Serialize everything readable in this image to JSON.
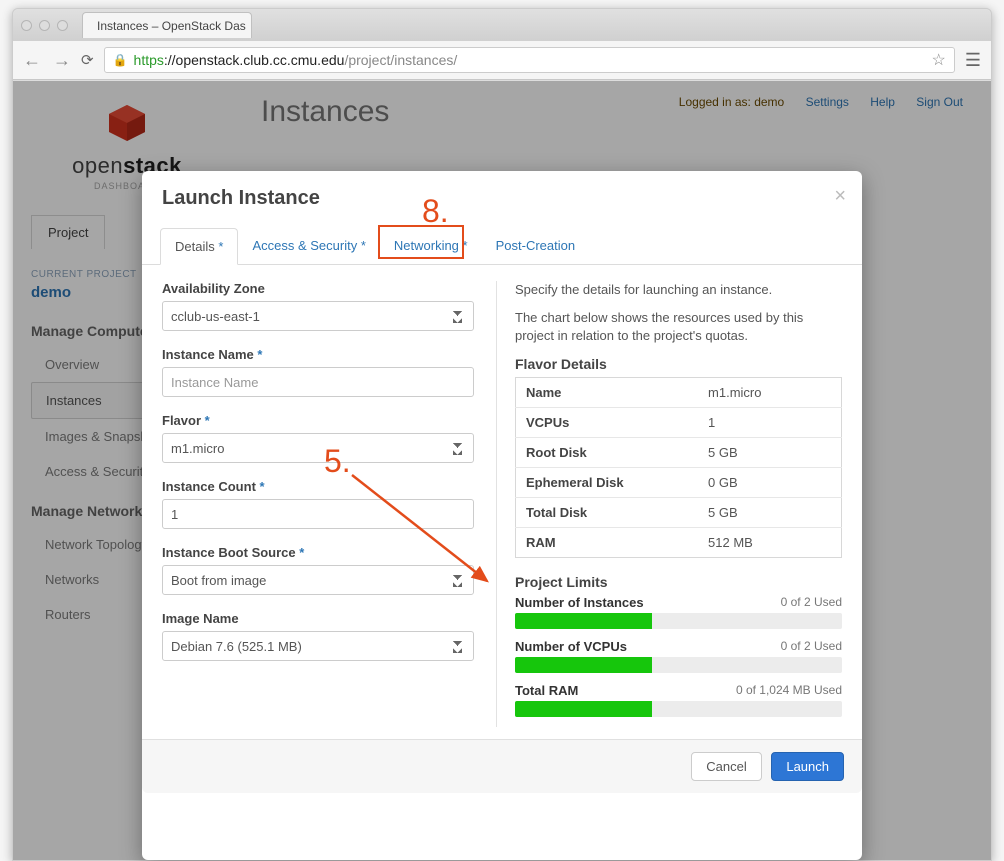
{
  "browser": {
    "tab_title": "Instances – OpenStack Das",
    "url_https": "https",
    "url_host": "://openstack.club.cc.cmu.edu",
    "url_path": "/project/instances/"
  },
  "sidebar": {
    "brand_open": "open",
    "brand_stack": "stack",
    "brand_sub": "DASHBOARD",
    "project_tab": "Project",
    "current_project_caption": "CURRENT PROJECT",
    "current_project": "demo",
    "compute_head": "Manage Compute",
    "compute_items": [
      "Overview",
      "Instances",
      "Images & Snapshots",
      "Access & Security"
    ],
    "network_head": "Manage Network",
    "network_items": [
      "Network Topology",
      "Networks",
      "Routers"
    ]
  },
  "header": {
    "page_title": "Instances",
    "logged_in": "Logged in as: demo",
    "links": [
      "Settings",
      "Help",
      "Sign Out"
    ]
  },
  "modal": {
    "title": "Launch Instance",
    "tabs": [
      "Details",
      "Access & Security",
      "Networking",
      "Post-Creation"
    ],
    "form": {
      "az_label": "Availability Zone",
      "az_value": "cclub-us-east-1",
      "name_label": "Instance Name",
      "name_placeholder": "Instance Name",
      "flavor_label": "Flavor",
      "flavor_value": "m1.micro",
      "count_label": "Instance Count",
      "count_value": "1",
      "boot_label": "Instance Boot Source",
      "boot_value": "Boot from image",
      "image_label": "Image Name",
      "image_value": "Debian 7.6 (525.1 MB)"
    },
    "help1": "Specify the details for launching an instance.",
    "help2": "The chart below shows the resources used by this project in relation to the project's quotas.",
    "flavor_head": "Flavor Details",
    "flavor_rows": [
      {
        "k": "Name",
        "v": "m1.micro"
      },
      {
        "k": "VCPUs",
        "v": "1"
      },
      {
        "k": "Root Disk",
        "v": "5 GB"
      },
      {
        "k": "Ephemeral Disk",
        "v": "0 GB"
      },
      {
        "k": "Total Disk",
        "v": "5 GB"
      },
      {
        "k": "RAM",
        "v": "512 MB"
      }
    ],
    "limits_head": "Project Limits",
    "limits": [
      {
        "label": "Number of Instances",
        "used": "0 of 2 Used"
      },
      {
        "label": "Number of VCPUs",
        "used": "0 of 2 Used"
      },
      {
        "label": "Total RAM",
        "used": "0 of 1,024 MB Used"
      }
    ],
    "cancel": "Cancel",
    "launch": "Launch"
  },
  "callouts": {
    "n5": "5.",
    "n8": "8."
  }
}
